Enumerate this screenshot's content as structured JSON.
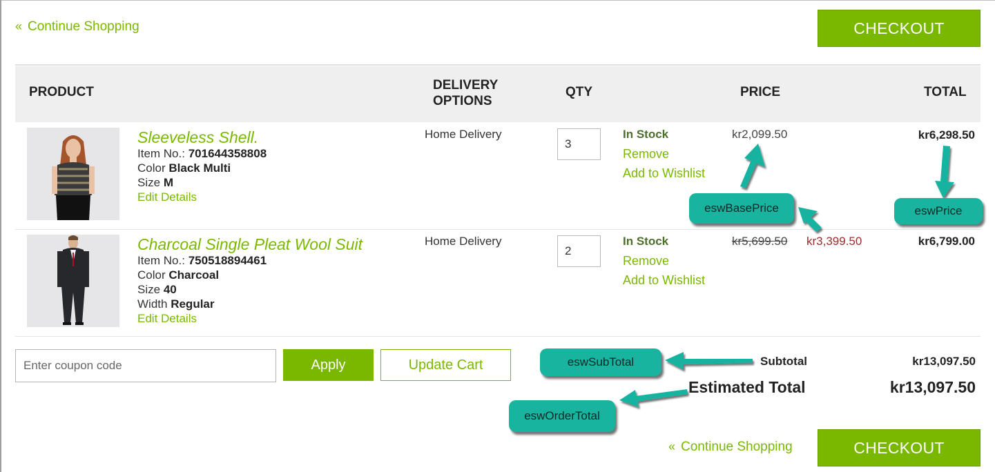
{
  "nav": {
    "continue_top": "Continue Shopping",
    "continue_bottom": "Continue Shopping",
    "checkout_top": "CHECKOUT",
    "checkout_bottom": "CHECKOUT"
  },
  "table_headers": {
    "product": "PRODUCT",
    "delivery_line1": "DELIVERY",
    "delivery_line2": "OPTIONS",
    "qty": "QTY",
    "price": "PRICE",
    "total": "TOTAL"
  },
  "items": [
    {
      "name": "Sleeveless Shell.",
      "item_label": "Item No.:",
      "item_no": "701644358808",
      "color_label": "Color",
      "color": "Black Multi",
      "size_label": "Size",
      "size": "M",
      "edit": "Edit Details",
      "delivery": "Home Delivery",
      "qty": "3",
      "stock": "In Stock",
      "remove": "Remove",
      "wishlist": "Add to Wishlist",
      "price": "kr2,099.50",
      "total": "kr6,298.50"
    },
    {
      "name": "Charcoal Single Pleat Wool Suit",
      "item_label": "Item No.:",
      "item_no": "750518894461",
      "color_label": "Color",
      "color": "Charcoal",
      "size_label": "Size",
      "size": "40",
      "width_label": "Width",
      "width": "Regular",
      "edit": "Edit Details",
      "delivery": "Home Delivery",
      "qty": "2",
      "stock": "In Stock",
      "remove": "Remove",
      "wishlist": "Add to Wishlist",
      "price_original": "kr5,699.50",
      "price_sale": "kr3,399.50",
      "total": "kr6,799.00"
    }
  ],
  "coupon": {
    "placeholder": "Enter coupon code",
    "apply": "Apply",
    "update": "Update Cart"
  },
  "summary": {
    "subtotal_label": "Subtotal",
    "subtotal": "kr13,097.50",
    "estimated_label": "Estimated Total",
    "estimated": "kr13,097.50"
  },
  "annotations": {
    "base_price": "eswBasePrice",
    "price": "eswPrice",
    "subtotal": "eswSubTotal",
    "order_total": "eswOrderTotal"
  },
  "colors": {
    "accent": "#7ab800",
    "annotation": "#19b4a0",
    "sale": "#9b2c2c",
    "in_stock": "#4d6e2a"
  }
}
